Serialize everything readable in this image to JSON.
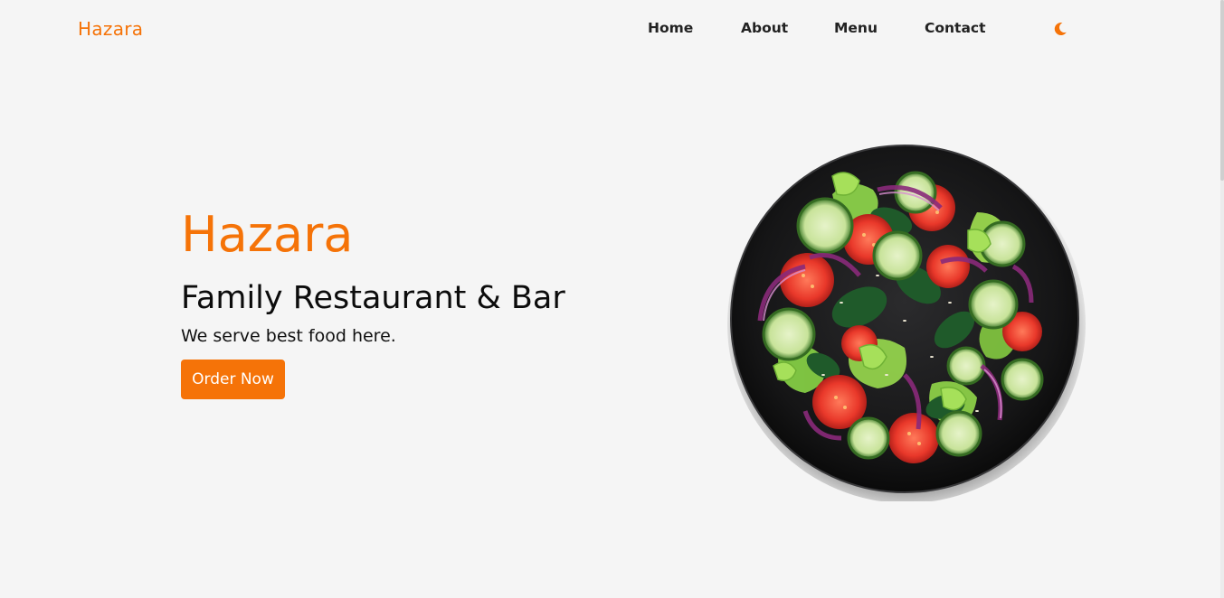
{
  "header": {
    "brand": "Hazara",
    "nav": [
      {
        "label": "Home"
      },
      {
        "label": "About"
      },
      {
        "label": "Menu"
      },
      {
        "label": "Contact"
      }
    ],
    "theme_icon": "moon-icon"
  },
  "hero": {
    "title": "Hazara",
    "subtitle": "Family Restaurant & Bar",
    "text": "We serve best food here.",
    "cta_label": "Order Now"
  },
  "image": {
    "subject": "salad-bowl-image"
  },
  "colors": {
    "accent": "#f57308",
    "background": "#f5f5f5",
    "text": "#0c0c0c"
  }
}
